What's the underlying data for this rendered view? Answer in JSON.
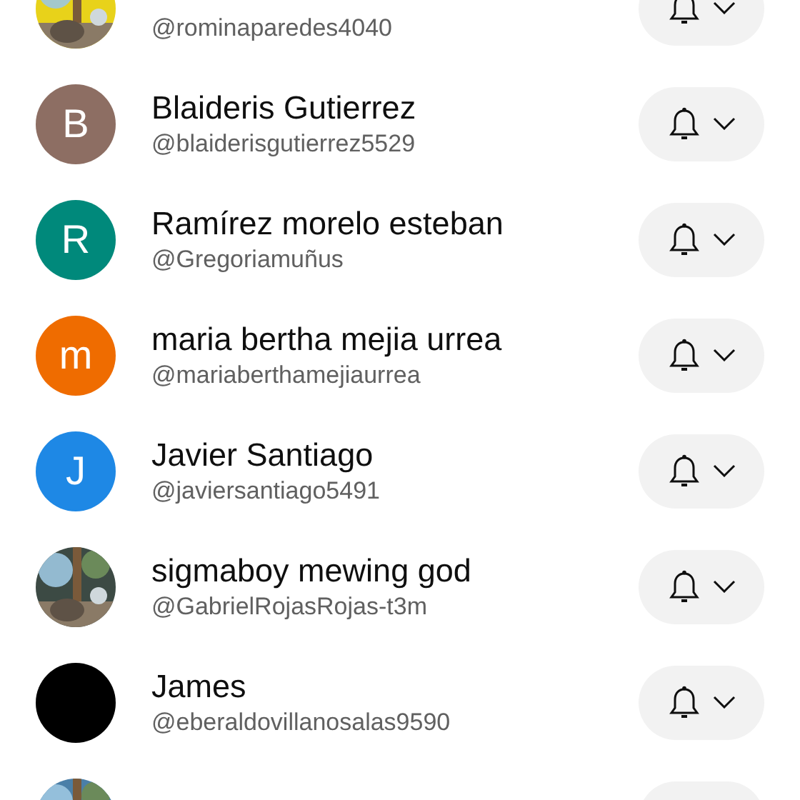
{
  "channels": [
    {
      "handle": "@rominaparedes4040",
      "avatar": {
        "kind": "picture"
      }
    },
    {
      "name": "Blaideris Gutierrez",
      "handle": "@blaiderisgutierrez5529",
      "avatar": {
        "kind": "letter",
        "letter": "B",
        "color": "#8d6e63"
      }
    },
    {
      "name": "Ramírez morelo esteban",
      "handle": "@Gregoriamuñus",
      "avatar": {
        "kind": "letter",
        "letter": "R",
        "color": "#00897b"
      }
    },
    {
      "name": "maria bertha mejia urrea",
      "handle": "@mariaberthamejiaurrea",
      "avatar": {
        "kind": "letter",
        "letter": "m",
        "color": "#ef6c00"
      }
    },
    {
      "name": "Javier Santiago",
      "handle": "@javiersantiago5491",
      "avatar": {
        "kind": "letter",
        "letter": "J",
        "color": "#1e88e5"
      }
    },
    {
      "name": "sigmaboy mewing god",
      "handle": "@GabrielRojasRojas-t3m",
      "avatar": {
        "kind": "picture"
      }
    },
    {
      "name": "James",
      "handle": "@eberaldovillanosalas9590",
      "avatar": {
        "kind": "solid",
        "color": "#000000"
      }
    },
    {
      "avatar": {
        "kind": "picture"
      }
    }
  ]
}
